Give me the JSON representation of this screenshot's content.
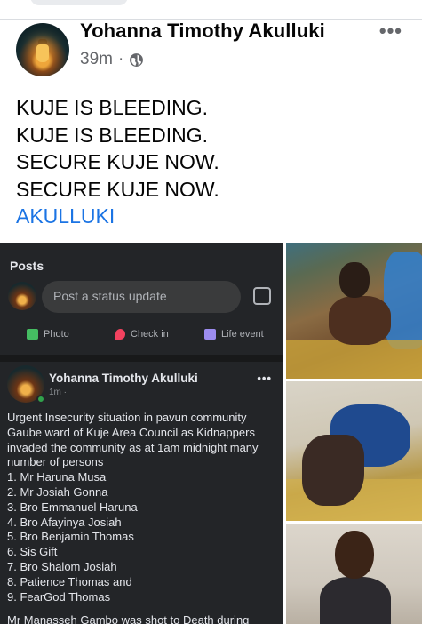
{
  "post": {
    "author": "Yohanna Timothy Akulluki",
    "time": "39m",
    "separator": "·",
    "more_label": "•••",
    "lines": [
      "KUJE IS BLEEDING.",
      "KUJE IS BLEEDING.",
      "SECURE KUJE NOW.",
      "SECURE KUJE NOW."
    ],
    "hashtag": "AKULLUKI"
  },
  "screenshot": {
    "section_title": "Posts",
    "status_placeholder": "Post a status update",
    "actions": [
      {
        "label": "Photo",
        "icon": "photo-icon",
        "color": "#45bd62"
      },
      {
        "label": "Check in",
        "icon": "location-pin-icon",
        "color": "#f3425f"
      },
      {
        "label": "Life event",
        "icon": "flag-icon",
        "color": "#9c8cf0"
      }
    ],
    "author": "Yohanna Timothy Akulluki",
    "time": "1m · ",
    "more_label": "•••",
    "intro": "Urgent Insecurity situation in pavun community Gaube ward of Kuje Area Council as Kidnappers invaded the community as at 1am midnight many number of persons",
    "list": [
      "1. Mr Haruna Musa",
      "2. Mr Josiah Gonna",
      "3. Bro Emmanuel Haruna",
      "4. Bro Afayinya Josiah",
      "5. Bro Benjamin Thomas",
      "6. Sis Gift",
      "7. Bro Shalom Josiah",
      "8. Patience Thomas and",
      "9. FearGod  Thomas"
    ],
    "tail": "Mr Manasseh Gambo was shot to Death during"
  },
  "colors": {
    "hashtag": "#1b74e4",
    "meta_text": "#65676b",
    "dark_bg": "#232528"
  }
}
